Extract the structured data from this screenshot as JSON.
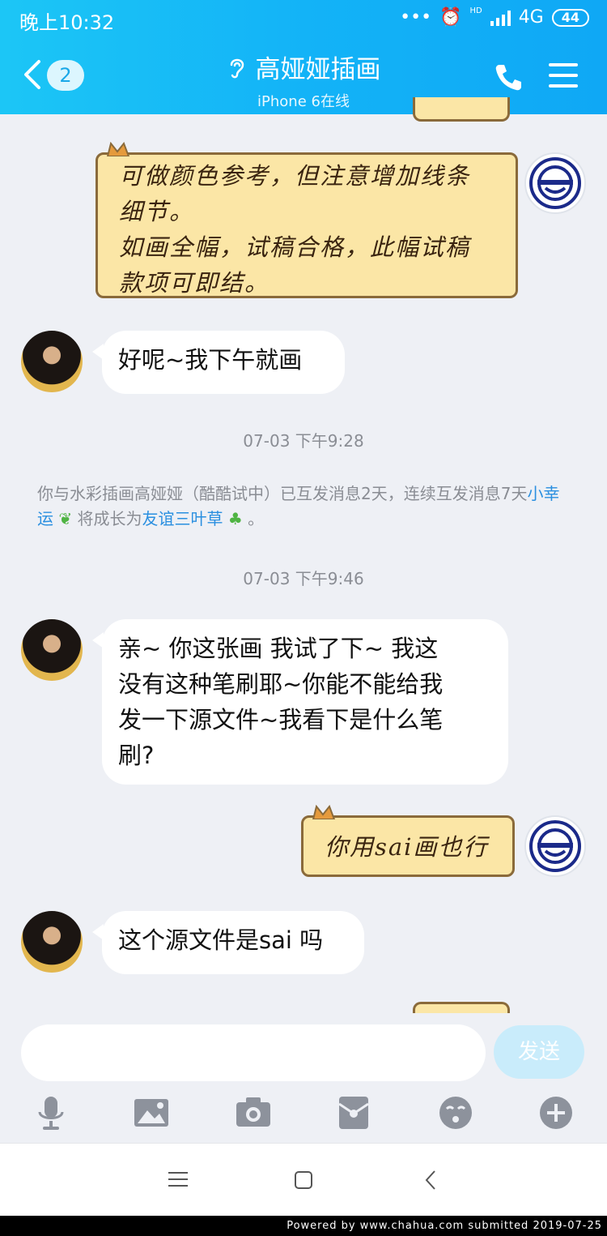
{
  "status_bar": {
    "time": "晚上10:32",
    "network": "4G",
    "hd": "HD",
    "battery": "44"
  },
  "header": {
    "unread_count": "2",
    "title": "高娅娅插画",
    "subtitle": "iPhone 6在线"
  },
  "messages": {
    "m1": {
      "line1": "可做颜色参考，但注意增加线条",
      "line2": "细节。",
      "line3": "如画全幅，试稿合格，此幅试稿",
      "line4": "款项可即结。"
    },
    "m2": {
      "text": "好呢~我下午就画"
    },
    "ts1": "07-03 下午9:28",
    "sys1": {
      "part1": "你与水彩插画高娅娅（酷酷试中）已互发消息2天，连续互发消息7天",
      "link1": "小幸运",
      "part2": "将成长为",
      "link2": "友谊三叶草",
      "part3": "。"
    },
    "ts2": "07-03 下午9:46",
    "m3": {
      "line1": "亲~ 你这张画 我试了下~ 我这",
      "line2": "没有这种笔刷耶~你能不能给我",
      "line3": "发一下源文件~我看下是什么笔",
      "line4": "刷?"
    },
    "m4": {
      "text": "你用sai画也行"
    },
    "m5": {
      "text": "这个源文件是sai 吗"
    }
  },
  "input": {
    "send_label": "发送"
  },
  "footer": {
    "text": "Powered  by  www.chahua.com  submitted  2019-07-25"
  },
  "colors": {
    "header": "#13b3f7",
    "background": "#eef0f5",
    "sticky": "#fbe6a6",
    "link": "#2a8fe0"
  }
}
